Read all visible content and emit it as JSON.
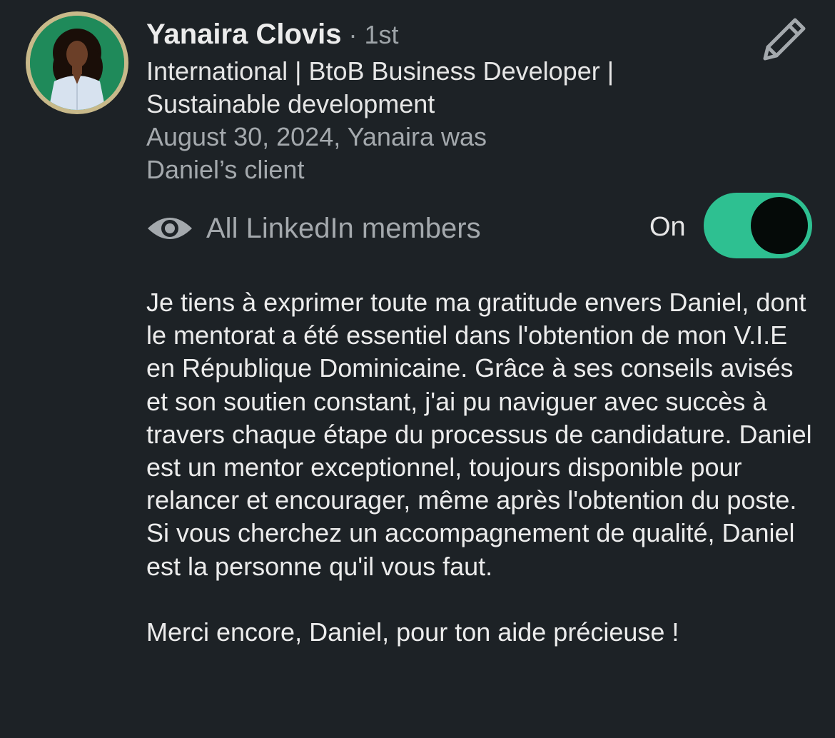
{
  "profile": {
    "name": "Yanaira Clovis",
    "degree": " · 1st",
    "headline": "International | BtoB Business Developer | Sustainable development",
    "relation": "August 30, 2024, Yanaira was Daniel’s client",
    "avatar_icon": "profile-photo"
  },
  "actions": {
    "edit_icon": "pencil-icon"
  },
  "visibility": {
    "icon": "eye-icon",
    "label": "All LinkedIn members",
    "status": "On",
    "enabled": true,
    "toggle_color": "#2ec091"
  },
  "recommendation": {
    "paragraph_1": "Je tiens à exprimer toute ma gratitude envers Daniel, dont le mentorat a été essentiel dans l'obtention de mon V.I.E en République Dominicaine. Grâce à ses conseils avisés et son soutien constant, j'ai pu naviguer avec succès à travers chaque étape du processus de candidature. Daniel est un mentor exceptionnel, toujours disponible pour relancer et encourager, même après l'obtention du poste. Si vous cherchez un accompagnement de qualité, Daniel est la personne qu'il vous faut.",
    "paragraph_2": "Merci encore, Daniel, pour ton aide précieuse !"
  },
  "colors": {
    "background": "#1d2226",
    "avatar_ring": "#c8b98a",
    "avatar_bg": "#1f8a5a"
  }
}
